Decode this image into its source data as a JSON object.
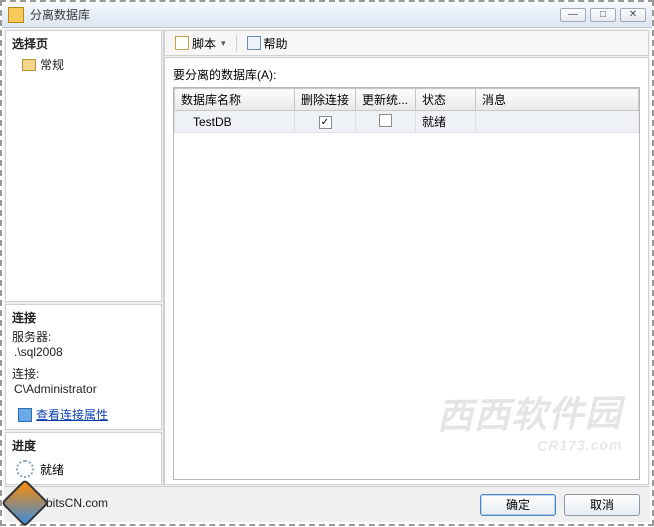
{
  "window": {
    "title": "分离数据库",
    "controls": {
      "minimize": "—",
      "maximize": "□",
      "close": "✕"
    }
  },
  "sidebar": {
    "select_page_title": "选择页",
    "items": [
      {
        "label": "常规"
      }
    ],
    "connection_title": "连接",
    "server_label": "服务器:",
    "server_value": ".\\sql2008",
    "conn_label": "连接:",
    "conn_value": "C\\Administrator",
    "view_conn_props": "查看连接属性",
    "progress_title": "进度",
    "progress_status": "就绪"
  },
  "toolbar": {
    "script_label": "脚本",
    "help_label": "帮助"
  },
  "main": {
    "prompt": "要分离的数据库(A):",
    "columns": {
      "db_name": "数据库名称",
      "drop_conn": "删除连接",
      "update_stats": "更新统...",
      "status": "状态",
      "message": "消息"
    },
    "rows": [
      {
        "db_name": "TestDB",
        "drop_conn": true,
        "update_stats": false,
        "status": "就绪",
        "message": ""
      }
    ]
  },
  "buttons": {
    "ok": "确定",
    "cancel": "取消"
  },
  "watermark": {
    "line1": "西西软件园",
    "line2": "CR173.com",
    "corner_text": "bitsCN.com"
  }
}
